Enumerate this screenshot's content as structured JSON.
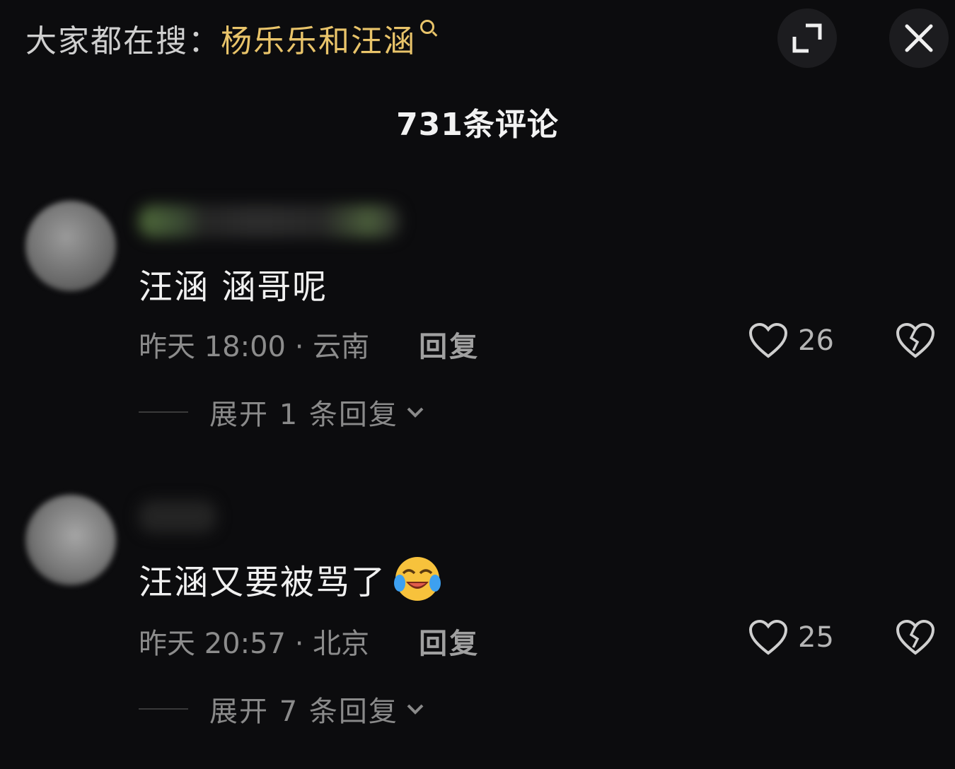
{
  "header": {
    "search_prefix": "大家都在搜：",
    "search_term": "杨乐乐和汪涵",
    "expand_icon": "expand-icon",
    "close_icon": "close-icon"
  },
  "comments_title": "731条评论",
  "comments": [
    {
      "text": "汪涵 涵哥呢",
      "meta": "昨天 18:00 · 云南",
      "reply_label": "回复",
      "likes": "26",
      "expand_label": "展开 1 条回复"
    },
    {
      "text": "汪涵又要被骂了",
      "emoji": "crying-laughing-emoji",
      "meta": "昨天 20:57 · 北京",
      "reply_label": "回复",
      "likes": "25",
      "expand_label": "展开 7 条回复"
    }
  ]
}
